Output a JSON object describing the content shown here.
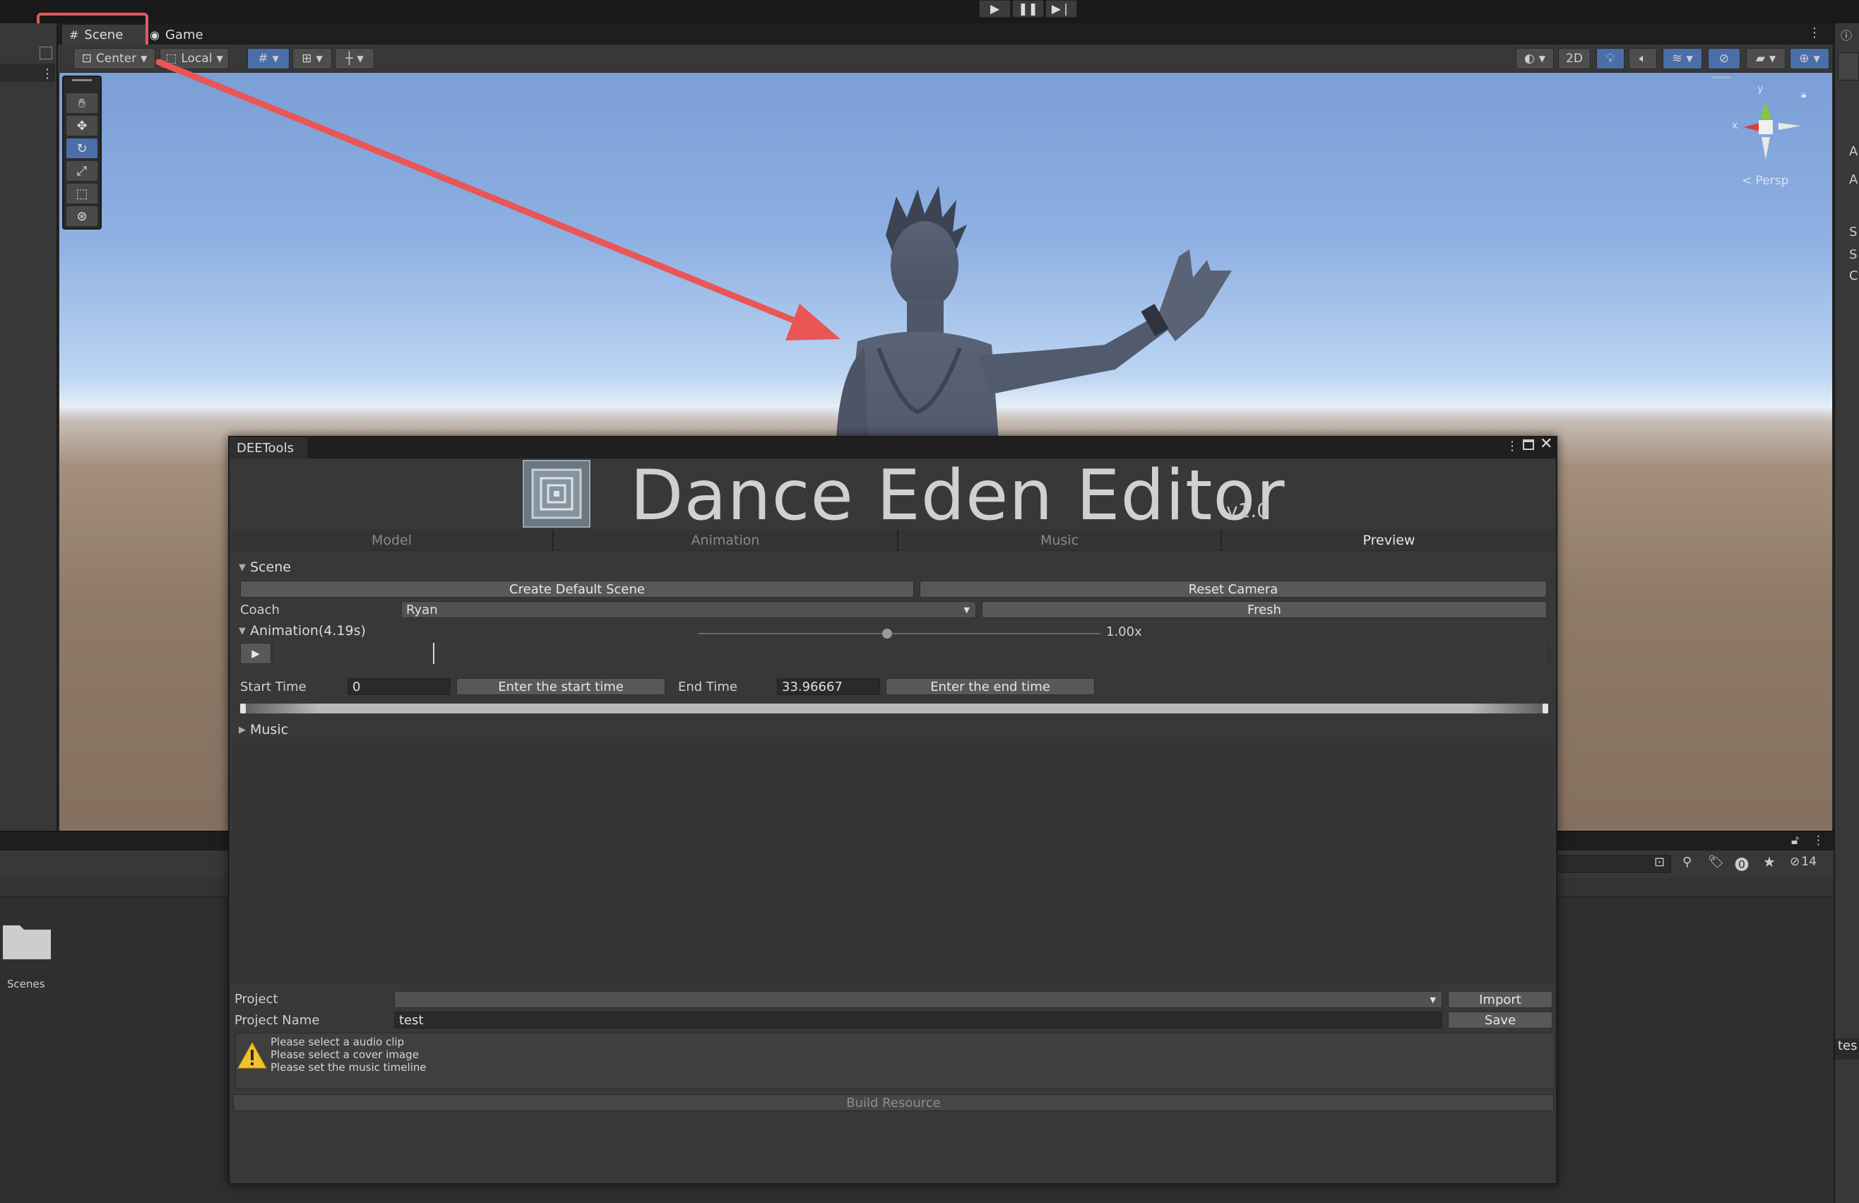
{
  "toolbar": {
    "play_icon": "play-icon",
    "pause_icon": "pause-icon",
    "step_icon": "step-icon"
  },
  "tabs": {
    "scene": "Scene",
    "game": "Game"
  },
  "scene_toolbar": {
    "pivot": "Center",
    "space": "Local",
    "mode_2d": "2D"
  },
  "gizmo": {
    "x_axis": "x",
    "y_axis": "y",
    "projection": "Persp"
  },
  "bottom": {
    "folder_label": "Scenes",
    "hidden_count": "14"
  },
  "right_panel": {
    "letters": [
      "A",
      "A",
      "S",
      "S",
      "C"
    ],
    "bottom_text": "tes"
  },
  "dee": {
    "window_tab": "DEETools",
    "title": "Dance Eden Editor",
    "version": "v1.0",
    "tabs": [
      "Model",
      "Animation",
      "Music",
      "Preview"
    ],
    "selected_tab": "Preview",
    "scene_section": {
      "label": "Scene",
      "create_default_scene": "Create Default Scene",
      "reset_camera": "Reset Camera",
      "coach_label": "Coach",
      "coach_value": "Ryan",
      "fresh": "Fresh"
    },
    "animation_section": {
      "label": "Animation(4.19s)",
      "speed": "1.00x",
      "speed_fraction": 0.47,
      "start_time_label": "Start Time",
      "start_time_value": "0",
      "enter_start": "Enter the start time",
      "end_time_label": "End Time",
      "end_time_value": "33.96667",
      "enter_end": "Enter the end time"
    },
    "music_section": {
      "label": "Music"
    },
    "project": {
      "project_label": "Project",
      "project_value": "",
      "import": "Import",
      "name_label": "Project Name",
      "name_value": "test",
      "save": "Save"
    },
    "warnings": [
      "Please select a audio clip",
      "Please select a cover image",
      "Please set the music timeline"
    ],
    "build_resource": "Build Resource"
  }
}
